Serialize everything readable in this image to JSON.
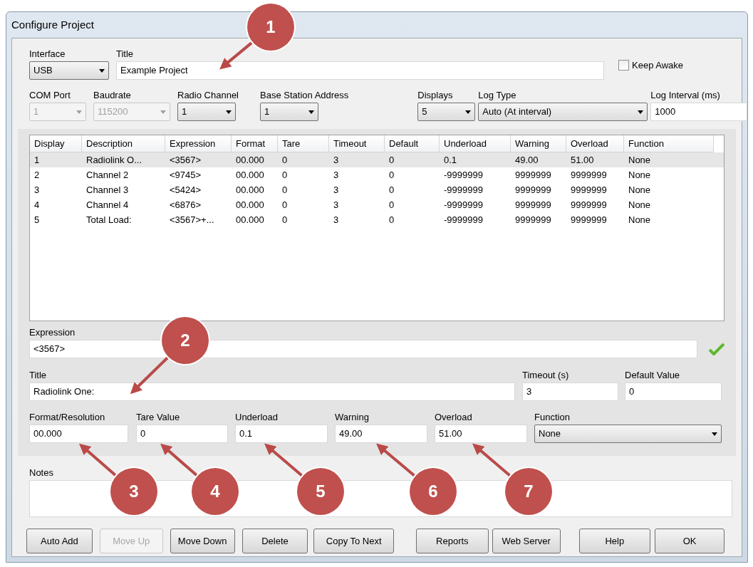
{
  "window": {
    "title": "Configure Project"
  },
  "top_row": {
    "interface": {
      "label": "Interface",
      "value": "USB"
    },
    "title": {
      "label": "Title",
      "value": "Example Project"
    },
    "keep_awake": {
      "label": "Keep Awake",
      "checked": false
    }
  },
  "settings": [
    {
      "label": "COM Port",
      "value": "1",
      "kind": "select",
      "disabled": true
    },
    {
      "label": "Baudrate",
      "value": "115200",
      "kind": "select",
      "disabled": true
    },
    {
      "label": "Radio Channel",
      "value": "1",
      "kind": "select",
      "disabled": false
    },
    {
      "label": "Base Station Address",
      "value": "1",
      "kind": "select",
      "disabled": false
    },
    {
      "label": "Displays",
      "value": "5",
      "kind": "select",
      "disabled": false
    },
    {
      "label": "Log Type",
      "value": "Auto (At interval)",
      "kind": "select",
      "disabled": false
    },
    {
      "label": "Log Interval (ms)",
      "value": "1000",
      "kind": "text"
    }
  ],
  "table": {
    "columns": [
      "Display",
      "Description",
      "Expression",
      "Format",
      "Tare",
      "Timeout",
      "Default",
      "Underload",
      "Warning",
      "Overload",
      "Function"
    ],
    "rows": [
      {
        "selected": true,
        "cells": [
          "1",
          "Radiolink O...",
          "<3567>",
          "00.000",
          "0",
          "3",
          "0",
          "0.1",
          "49.00",
          "51.00",
          "None"
        ]
      },
      {
        "selected": false,
        "cells": [
          "2",
          "Channel 2",
          "<9745>",
          "00.000",
          "0",
          "3",
          "0",
          "-9999999",
          "9999999",
          "9999999",
          "None"
        ]
      },
      {
        "selected": false,
        "cells": [
          "3",
          "Channel 3",
          "<5424>",
          "00.000",
          "0",
          "3",
          "0",
          "-9999999",
          "9999999",
          "9999999",
          "None"
        ]
      },
      {
        "selected": false,
        "cells": [
          "4",
          "Channel 4",
          "<6876>",
          "00.000",
          "0",
          "3",
          "0",
          "-9999999",
          "9999999",
          "9999999",
          "None"
        ]
      },
      {
        "selected": false,
        "cells": [
          "5",
          "Total Load:",
          "<3567>+...",
          "00.000",
          "0",
          "3",
          "0",
          "-9999999",
          "9999999",
          "9999999",
          "None"
        ]
      }
    ]
  },
  "expression": {
    "label": "Expression",
    "value": "<3567>",
    "valid": true
  },
  "title_row": [
    {
      "label": "Title",
      "value": "Radiolink One:",
      "kind": "text"
    },
    {
      "label": "Timeout (s)",
      "value": "3",
      "kind": "text"
    },
    {
      "label": "Default Value",
      "value": "0",
      "kind": "text"
    }
  ],
  "value_row": [
    {
      "label": "Format/Resolution",
      "value": "00.000",
      "kind": "text"
    },
    {
      "label": "Tare Value",
      "value": "0",
      "kind": "text"
    },
    {
      "label": "Underload",
      "value": "0.1",
      "kind": "text"
    },
    {
      "label": "Warning",
      "value": "49.00",
      "kind": "text"
    },
    {
      "label": "Overload",
      "value": "51.00",
      "kind": "text"
    },
    {
      "label": "Function",
      "value": "None",
      "kind": "select"
    }
  ],
  "notes": {
    "label": "Notes"
  },
  "buttons": [
    {
      "label": "Auto Add",
      "disabled": false
    },
    {
      "label": "Move Up",
      "disabled": true
    },
    {
      "label": "Move Down",
      "disabled": false
    },
    {
      "label": "Delete",
      "disabled": false
    },
    {
      "label": "Copy To Next",
      "disabled": false
    },
    {
      "label": "Reports",
      "disabled": false
    },
    {
      "label": "Web Server",
      "disabled": false
    },
    {
      "label": "Help",
      "disabled": false
    },
    {
      "label": "OK",
      "disabled": false
    }
  ],
  "callouts": [
    {
      "label": "1"
    },
    {
      "label": "2"
    },
    {
      "label": "3"
    },
    {
      "label": "4"
    },
    {
      "label": "5"
    },
    {
      "label": "6"
    },
    {
      "label": "7"
    }
  ]
}
